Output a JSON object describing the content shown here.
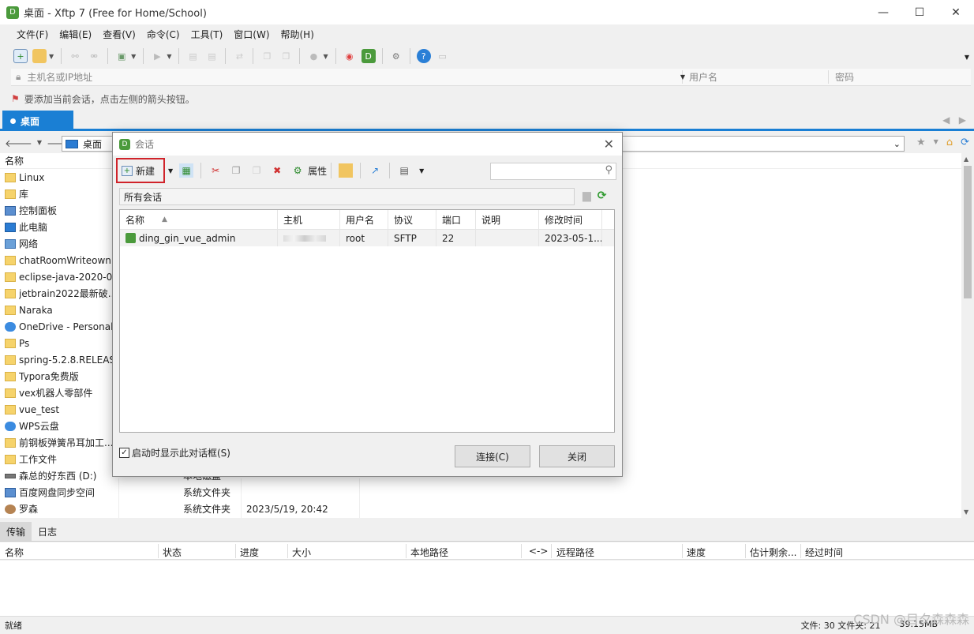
{
  "window": {
    "title": "桌面 - Xftp 7 (Free for Home/School)",
    "app_icon_text": "D",
    "min": "—",
    "max": "☐",
    "close": "✕"
  },
  "menu": [
    "文件(F)",
    "编辑(E)",
    "查看(V)",
    "命令(C)",
    "工具(T)",
    "窗口(W)",
    "帮助(H)"
  ],
  "address": {
    "host_placeholder": "主机名或IP地址",
    "user_placeholder": "用户名",
    "password_placeholder": "密码"
  },
  "hint": "要添加当前会话，点击左侧的箭头按钮。",
  "tab": {
    "label": "桌面"
  },
  "path": {
    "current": "桌面"
  },
  "left_pane": {
    "header_name": "名称",
    "items": [
      {
        "name": "Linux",
        "icon": "folder"
      },
      {
        "name": "库",
        "icon": "folder"
      },
      {
        "name": "控制面板",
        "icon": "ctrl"
      },
      {
        "name": "此电脑",
        "icon": "pcicon"
      },
      {
        "name": "网络",
        "icon": "net"
      },
      {
        "name": "chatRoomWriteown",
        "icon": "folder"
      },
      {
        "name": "eclipse-java-2020-0...",
        "icon": "folder"
      },
      {
        "name": "jetbrain2022最新破...",
        "icon": "folder"
      },
      {
        "name": "Naraka",
        "icon": "folder"
      },
      {
        "name": "OneDrive - Personal",
        "icon": "cloud"
      },
      {
        "name": "Ps",
        "icon": "folder"
      },
      {
        "name": "spring-5.2.8.RELEAS...",
        "icon": "folder"
      },
      {
        "name": "Typora免费版",
        "icon": "folder"
      },
      {
        "name": "vex机器人零部件",
        "icon": "folder"
      },
      {
        "name": "vue_test",
        "icon": "folder"
      },
      {
        "name": "WPS云盘",
        "icon": "cloud"
      },
      {
        "name": "前钢板弹簧吊耳加工...",
        "icon": "folder"
      },
      {
        "name": "工作文件",
        "icon": "folder"
      },
      {
        "name": "森总的好东西 (D:)",
        "icon": "drive",
        "type": "本地磁盘"
      },
      {
        "name": "百度网盘同步空间",
        "icon": "ctrl",
        "type": "系统文件夹"
      },
      {
        "name": "罗森",
        "icon": "person",
        "type": "系统文件夹",
        "date": "2023/5/19, 20:42"
      }
    ]
  },
  "bottom": {
    "tabs": [
      "传输",
      "日志"
    ],
    "columns": [
      "名称",
      "状态",
      "进度",
      "大小",
      "本地路径",
      "<->",
      "远程路径",
      "速度",
      "估计剩余...",
      "经过时间"
    ]
  },
  "status": {
    "left": "就绪",
    "files": "文件: 30  文件夹: 21",
    "size": "39.15MB"
  },
  "watermark": "CSDN @目夕森森森",
  "dialog": {
    "title": "会话",
    "new_label": "新建",
    "properties_label": "属性",
    "folder_path": "所有会话",
    "columns": [
      "名称",
      "主机",
      "用户名",
      "协议",
      "端口",
      "说明",
      "修改时间"
    ],
    "sessions": [
      {
        "name": "ding_gin_vue_admin",
        "host": "",
        "user": "root",
        "protocol": "SFTP",
        "port": "22",
        "desc": "",
        "modified": "2023-05-1..."
      }
    ],
    "startup_label": "启动时显示此对话框(S)",
    "connect_label": "连接(C)",
    "close_label": "关闭"
  },
  "colors": {
    "accent": "#1a7fd4",
    "highlight_border": "#d0232a",
    "app_green": "#4b9a3c"
  }
}
